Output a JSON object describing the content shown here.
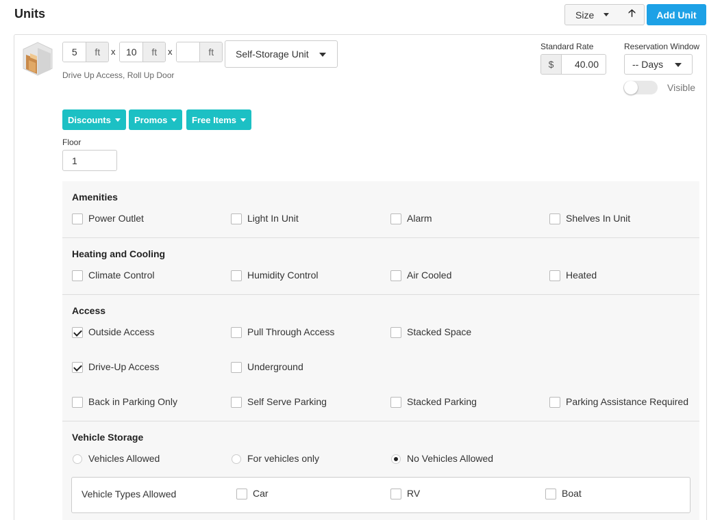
{
  "header": {
    "title": "Units",
    "sort_label": "Size",
    "sort_dir_icon": "up-arrow-icon",
    "add_unit_label": "Add Unit",
    "add_unit_color": "#1da1e6"
  },
  "unit": {
    "icon": "storage-unit-icon",
    "width": "5",
    "length": "10",
    "height": "",
    "dim_unit": "ft",
    "times": "x",
    "type": "Self-Storage Unit",
    "features": "Drive Up Access, Roll Up Door",
    "standard_rate_label": "Standard Rate",
    "currency": "$",
    "standard_rate": "40.00",
    "reservation_window_label": "Reservation Window",
    "reservation_window_value": "-- Days",
    "visible_label": "Visible",
    "visible_on": false,
    "buttons": {
      "discounts": "Discounts",
      "promos": "Promos",
      "free_items": "Free Items",
      "color": "#1cc0c4"
    },
    "floor_label": "Floor",
    "floor_value": "1"
  },
  "sections": {
    "amenities": {
      "title": "Amenities",
      "options": [
        {
          "label": "Power Outlet",
          "checked": false
        },
        {
          "label": "Light In Unit",
          "checked": false
        },
        {
          "label": "Alarm",
          "checked": false
        },
        {
          "label": "Shelves In Unit",
          "checked": false
        }
      ]
    },
    "heating": {
      "title": "Heating and Cooling",
      "options": [
        {
          "label": "Climate Control",
          "checked": false
        },
        {
          "label": "Humidity Control",
          "checked": false
        },
        {
          "label": "Air Cooled",
          "checked": false
        },
        {
          "label": "Heated",
          "checked": false
        }
      ]
    },
    "access": {
      "title": "Access",
      "options": [
        {
          "label": "Outside Access",
          "checked": true
        },
        {
          "label": "Pull Through Access",
          "checked": false
        },
        {
          "label": "Stacked Space",
          "checked": false
        },
        {
          "label": "Drive-Up Access",
          "checked": true
        },
        {
          "label": "Underground",
          "checked": false
        },
        {
          "label": "Back in Parking Only",
          "checked": false
        },
        {
          "label": "Self Serve Parking",
          "checked": false
        },
        {
          "label": "Stacked Parking",
          "checked": false
        },
        {
          "label": "Parking Assistance Required",
          "checked": false
        }
      ]
    },
    "vehicle": {
      "title": "Vehicle Storage",
      "radios": [
        {
          "label": "Vehicles Allowed",
          "selected": false
        },
        {
          "label": "For vehicles only",
          "selected": false
        },
        {
          "label": "No Vehicles Allowed",
          "selected": true
        }
      ],
      "types_label": "Vehicle Types Allowed",
      "types": [
        {
          "label": "Car",
          "checked": false
        },
        {
          "label": "RV",
          "checked": false
        },
        {
          "label": "Boat",
          "checked": false
        }
      ]
    }
  }
}
